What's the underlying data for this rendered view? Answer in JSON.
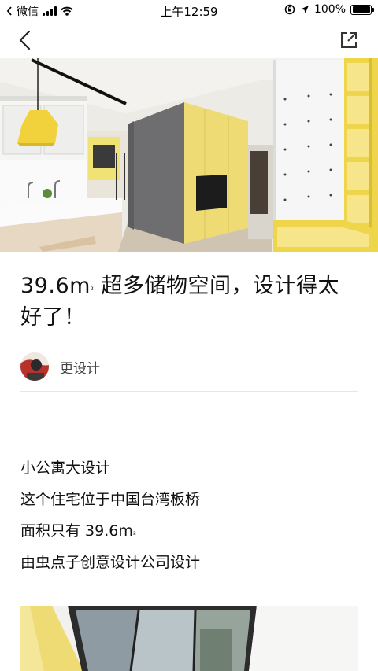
{
  "status_bar": {
    "carrier": "微信",
    "time": "上午12:59",
    "battery_text": "100%"
  },
  "nav": {
    "back_icon": "chevron-left-icon",
    "share_icon": "share-external-icon"
  },
  "article": {
    "title_number": "39.6m",
    "title_sup": "²",
    "title_rest": " 超多储物空间，设计得太好了！",
    "author": "更设计",
    "paragraphs": [
      " 小公寓大设计",
      "这个住宅位于中国台湾板桥"
    ],
    "area_line_prefix": "面积只有 39.6m",
    "area_line_sup": "²",
    "company_line": "由虫点子创意设计公司设计"
  },
  "colors": {
    "accent_yellow": "#f0dc6a",
    "wall_gray": "#6e6e70",
    "text": "#111111"
  }
}
